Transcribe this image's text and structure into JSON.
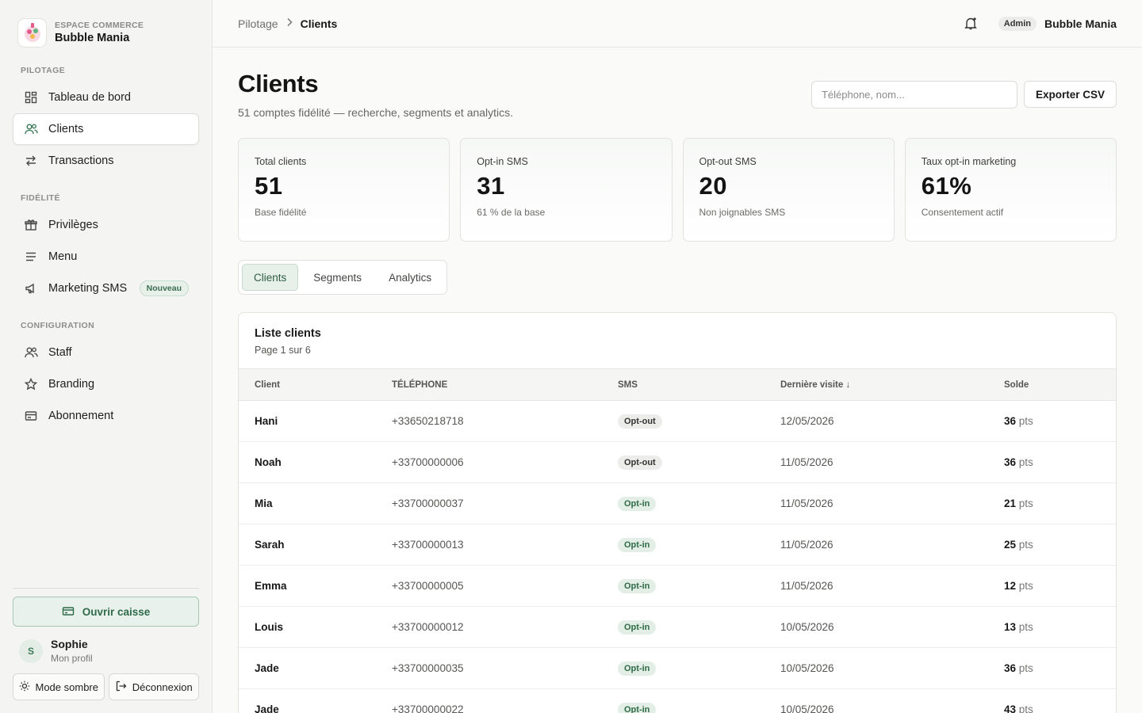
{
  "brand": {
    "eyebrow": "ESPACE COMMERCE",
    "name": "Bubble Mania"
  },
  "nav": {
    "sections": [
      {
        "label": "PILOTAGE",
        "items": [
          {
            "label": "Tableau de bord",
            "icon": "dashboard-icon"
          },
          {
            "label": "Clients",
            "icon": "users-icon",
            "active": true
          },
          {
            "label": "Transactions",
            "icon": "arrows-exchange-icon"
          }
        ]
      },
      {
        "label": "FIDÉLITÉ",
        "items": [
          {
            "label": "Privilèges",
            "icon": "gift-icon"
          },
          {
            "label": "Menu",
            "icon": "menu-lines-icon"
          },
          {
            "label": "Marketing SMS",
            "icon": "megaphone-icon",
            "badge": "Nouveau"
          }
        ]
      },
      {
        "label": "CONFIGURATION",
        "items": [
          {
            "label": "Staff",
            "icon": "staff-icon"
          },
          {
            "label": "Branding",
            "icon": "star-icon"
          },
          {
            "label": "Abonnement",
            "icon": "card-icon"
          }
        ]
      }
    ]
  },
  "sidebar_bottom": {
    "open_register": "Ouvrir caisse",
    "user_initial": "S",
    "user_name": "Sophie",
    "user_sub": "Mon profil",
    "dark_mode": "Mode sombre",
    "logout": "Déconnexion"
  },
  "topbar": {
    "crumb_parent": "Pilotage",
    "crumb_current": "Clients",
    "role": "Admin",
    "shop": "Bubble Mania"
  },
  "page": {
    "title": "Clients",
    "subtitle": "51 comptes fidélité — recherche, segments et analytics.",
    "search_placeholder": "Téléphone, nom...",
    "export_label": "Exporter CSV"
  },
  "stats": [
    {
      "label": "Total clients",
      "value": "51",
      "sub": "Base fidélité"
    },
    {
      "label": "Opt-in SMS",
      "value": "31",
      "sub": "61 % de la base"
    },
    {
      "label": "Opt-out SMS",
      "value": "20",
      "sub": "Non joignables SMS"
    },
    {
      "label": "Taux opt-in marketing",
      "value": "61%",
      "sub": "Consentement actif"
    }
  ],
  "tabs": [
    {
      "label": "Clients",
      "active": true
    },
    {
      "label": "Segments"
    },
    {
      "label": "Analytics"
    }
  ],
  "list": {
    "title": "Liste clients",
    "page_info": "Page 1 sur 6",
    "columns": [
      "Client",
      "TÉLÉPHONE",
      "SMS",
      "Dernière visite ↓",
      "Solde"
    ],
    "pts_unit": "pts",
    "rows": [
      {
        "client": "Hani",
        "phone": "+33650218718",
        "sms": "Opt-out",
        "last_visit": "12/05/2026",
        "balance": "36"
      },
      {
        "client": "Noah",
        "phone": "+33700000006",
        "sms": "Opt-out",
        "last_visit": "11/05/2026",
        "balance": "36"
      },
      {
        "client": "Mia",
        "phone": "+33700000037",
        "sms": "Opt-in",
        "last_visit": "11/05/2026",
        "balance": "21"
      },
      {
        "client": "Sarah",
        "phone": "+33700000013",
        "sms": "Opt-in",
        "last_visit": "11/05/2026",
        "balance": "25"
      },
      {
        "client": "Emma",
        "phone": "+33700000005",
        "sms": "Opt-in",
        "last_visit": "11/05/2026",
        "balance": "12"
      },
      {
        "client": "Louis",
        "phone": "+33700000012",
        "sms": "Opt-in",
        "last_visit": "10/05/2026",
        "balance": "13"
      },
      {
        "client": "Jade",
        "phone": "+33700000035",
        "sms": "Opt-in",
        "last_visit": "10/05/2026",
        "balance": "36"
      },
      {
        "client": "Jade",
        "phone": "+33700000022",
        "sms": "Opt-in",
        "last_visit": "10/05/2026",
        "balance": "43"
      }
    ]
  },
  "colors": {
    "accent": "#3b7a58",
    "accent_bg": "#e8f1eb",
    "optin_bg": "#e3efe6",
    "optout_bg": "#ececeb"
  }
}
